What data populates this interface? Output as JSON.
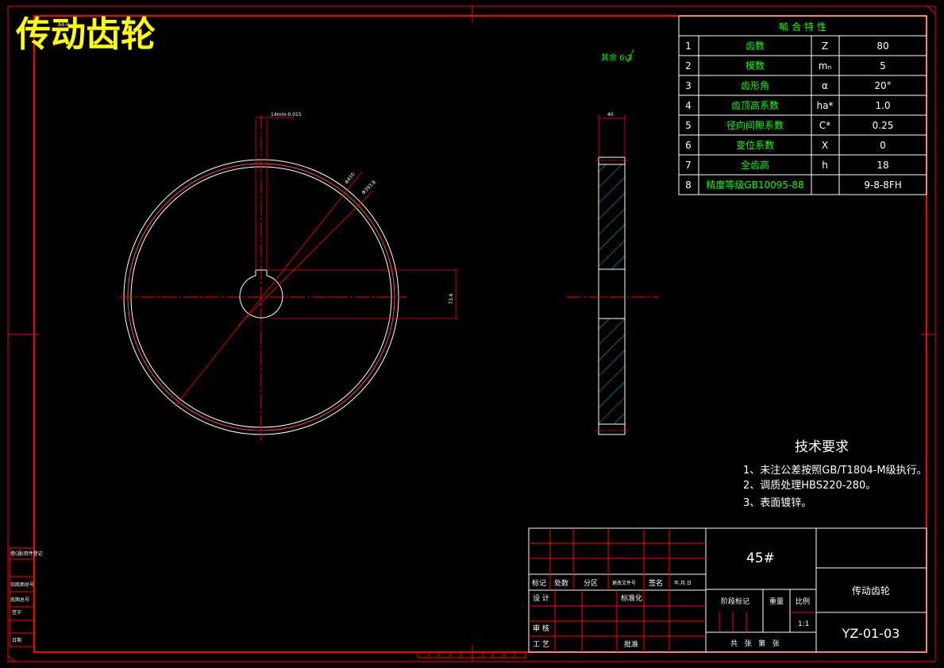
{
  "title": "传动齿轮",
  "drawing_size_tag": "A4-H",
  "roughness_note": "其余 6.3",
  "front_view": {
    "keyway_dim": "14mm-0.015",
    "dia_outer": "Φ410",
    "dia_root": "Φ393.8",
    "hub_dim": "73.4",
    "width_dim": "40"
  },
  "mesh_table": {
    "title": "啮 合 特 性",
    "rows": [
      {
        "no": "1",
        "name": "齿数",
        "sym": "Z",
        "val": "80"
      },
      {
        "no": "2",
        "name": "模数",
        "sym": "mₙ",
        "val": "5"
      },
      {
        "no": "3",
        "name": "齿形角",
        "sym": "α",
        "val": "20°"
      },
      {
        "no": "4",
        "name": "齿顶高系数",
        "sym": "ha*",
        "val": "1.0"
      },
      {
        "no": "5",
        "name": "径向间隙系数",
        "sym": "C*",
        "val": "0.25"
      },
      {
        "no": "6",
        "name": "变位系数",
        "sym": "X",
        "val": "0"
      },
      {
        "no": "7",
        "name": "全齿高",
        "sym": "h",
        "val": "18"
      },
      {
        "no": "8",
        "name": "精度等级GB10095-88",
        "sym": "",
        "val": "9-8-8FH"
      }
    ]
  },
  "tech_req": {
    "title": "技术要求",
    "items": [
      "1、未注公差按照GB/T1804-M级执行。",
      "2、调质处理HBS220-280。",
      "3、表面镀锌。"
    ]
  },
  "title_block": {
    "material": "45#",
    "part_name": "传动齿轮",
    "drawing_no": "YZ-01-03",
    "scale_value": "1:1",
    "labels": {
      "mark": "标记",
      "count": "处数",
      "zone": "分区",
      "change_doc": "更改文件号",
      "sign": "签名",
      "date": "年.月.日",
      "design": "设 计",
      "standard": "标准化",
      "check": "审 核",
      "process": "工 艺",
      "approve": "批准",
      "stage_mark": "阶段标记",
      "weight": "重量",
      "scale": "比例",
      "sheets": "共   张   第   张"
    }
  },
  "side_strip": {
    "items": [
      "借(通)用件登记",
      "旧底图总号",
      "底图总号",
      "签字",
      "日期"
    ]
  }
}
